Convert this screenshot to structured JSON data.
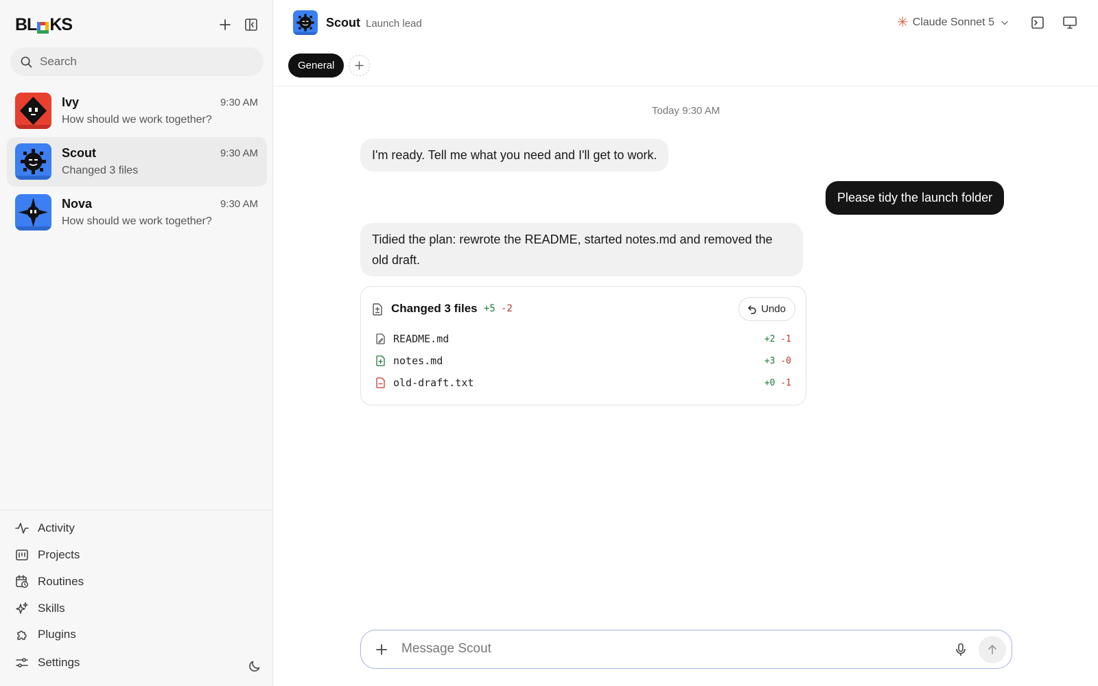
{
  "app": {
    "logo_text_1": "BL",
    "logo_text_2": "KS"
  },
  "sidebar": {
    "search_placeholder": "Search",
    "chats": [
      {
        "name": "Ivy",
        "time": "9:30 AM",
        "preview": "How should we work together?",
        "avatar_color": "#e8402f"
      },
      {
        "name": "Scout",
        "time": "9:30 AM",
        "preview": "Changed 3 files",
        "avatar_color": "#3b7ff2"
      },
      {
        "name": "Nova",
        "time": "9:30 AM",
        "preview": "How should we work together?",
        "avatar_color": "#3b7ff2"
      }
    ],
    "nav": [
      {
        "label": "Activity",
        "icon": "activity-icon"
      },
      {
        "label": "Projects",
        "icon": "projects-icon"
      },
      {
        "label": "Routines",
        "icon": "routines-icon"
      },
      {
        "label": "Skills",
        "icon": "skills-icon"
      },
      {
        "label": "Plugins",
        "icon": "plugins-icon"
      },
      {
        "label": "Settings",
        "icon": "settings-icon"
      }
    ]
  },
  "header": {
    "agent_name": "Scout",
    "agent_role": "Launch lead",
    "model": "Claude Sonnet 5",
    "tabs": [
      {
        "label": "General"
      }
    ]
  },
  "conversation": {
    "timestamp": "Today 9:30 AM",
    "messages": [
      {
        "role": "agent",
        "text": "I'm ready. Tell me what you need and I'll get to work."
      },
      {
        "role": "user",
        "text": "Please tidy the launch folder"
      },
      {
        "role": "agent",
        "text": "Tidied the plan: rewrote the README, started notes.md and removed the old draft."
      }
    ],
    "changes": {
      "title": "Changed 3 files",
      "added": "+5",
      "removed": "-2",
      "undo_label": "Undo",
      "files": [
        {
          "name": "README.md",
          "added": "+2",
          "removed": "-1",
          "status": "modified"
        },
        {
          "name": "notes.md",
          "added": "+3",
          "removed": "-0",
          "status": "added"
        },
        {
          "name": "old-draft.txt",
          "added": "+0",
          "removed": "-1",
          "status": "deleted"
        }
      ]
    }
  },
  "composer": {
    "placeholder": "Message Scout"
  },
  "colors": {
    "accent_dark": "#151515",
    "diff_add": "#1f7a3a",
    "diff_remove": "#c0392b",
    "composer_border": "#a9b0e8",
    "model_spark": "#d9674a"
  }
}
